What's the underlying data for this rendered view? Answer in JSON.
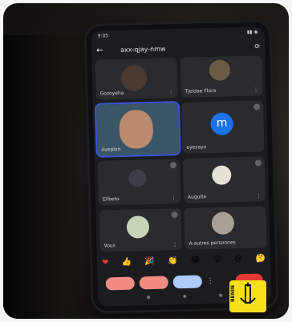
{
  "meeting": {
    "code": "axx-qjay-nmw",
    "status_time": "9:05",
    "participants": [
      {
        "name": "Gozoyeha"
      },
      {
        "name": "Tjeidae Flora"
      },
      {
        "name": "Aveplon"
      },
      {
        "name": "m",
        "label": "eyesayo"
      },
      {
        "name": "Ellbeto"
      },
      {
        "name": "Augulte"
      },
      {
        "name": "Vous"
      },
      {
        "name": "A-autres personnes"
      }
    ]
  },
  "reactions": [
    "❤",
    "👍",
    "🎉",
    "👏",
    "😂",
    "😮",
    "😢",
    "🤔"
  ],
  "logo": {
    "text": "BENIN"
  },
  "colors": {
    "active_tile": "#3b55d6",
    "end_call": "#e53935",
    "avatar_m": "#1a73e8",
    "logo_bg": "#f7e01a"
  }
}
